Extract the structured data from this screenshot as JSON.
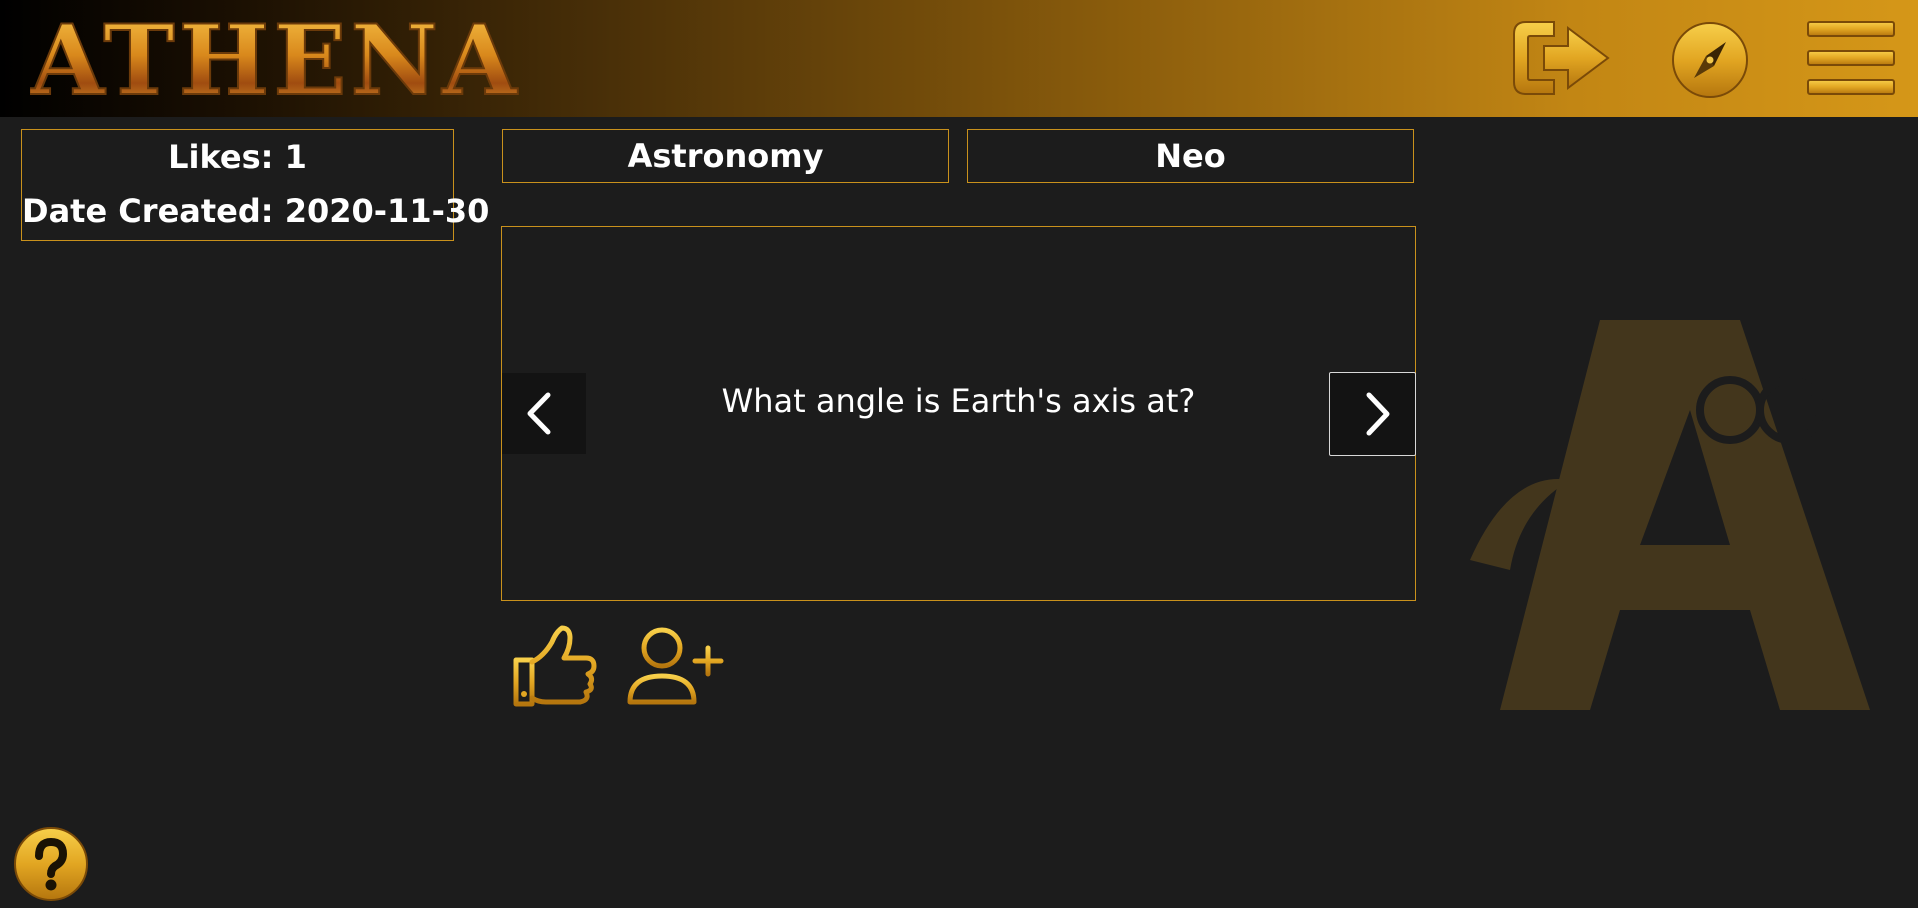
{
  "app": {
    "logo_text": "Athena"
  },
  "header": {
    "logout_icon": "logout-icon",
    "explore_icon": "compass-icon",
    "menu_icon": "hamburger-menu-icon"
  },
  "info": {
    "likes": "Likes: 1",
    "date_created": "Date Created: 2020-11-30"
  },
  "tags": {
    "subject": "Astronomy",
    "author": "Neo"
  },
  "card": {
    "question": "What angle is Earth's axis at?",
    "prev_icon": "chevron-left-icon",
    "next_icon": "chevron-right-icon"
  },
  "actions": {
    "like_icon": "thumbs-up-icon",
    "follow_icon": "add-user-icon"
  },
  "help": {
    "icon": "question-mark-icon"
  },
  "colors": {
    "background": "#1c1c1c",
    "accent_gold": "#c9911c",
    "header_gradient_start": "#000000",
    "header_gradient_end": "#d59718",
    "text": "#ffffff"
  }
}
